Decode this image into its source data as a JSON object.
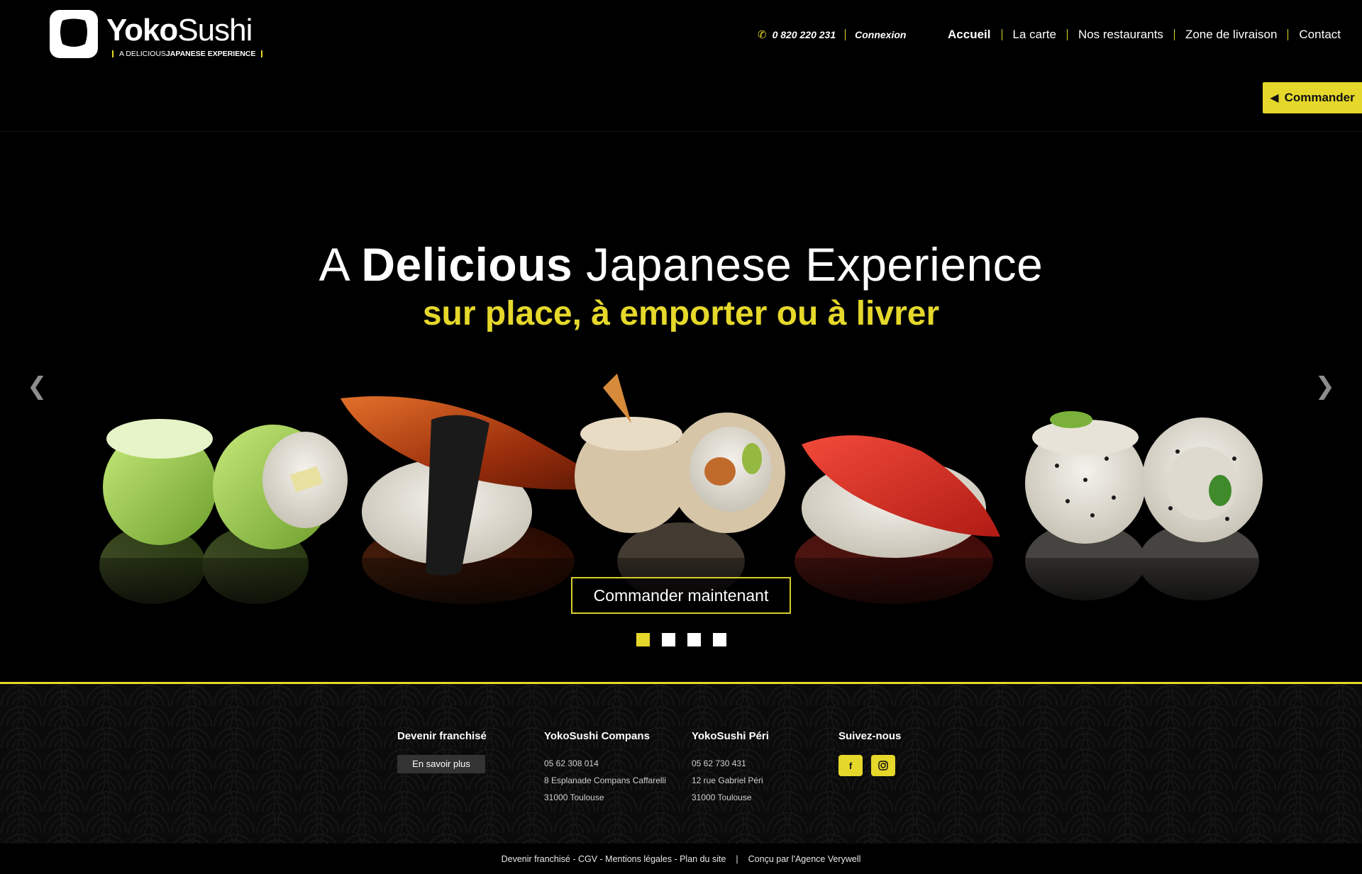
{
  "brand": {
    "name_bold": "Yoko",
    "name_light": "Sushi",
    "tagline_pre": "A DELICIOUS ",
    "tagline_bold": "JAPANESE EXPERIENCE",
    "accent_color": "#e5d82b"
  },
  "topbar": {
    "phone": "0 820 220 231",
    "phone_icon": "phone-icon",
    "login": "Connexion"
  },
  "nav": {
    "items": [
      {
        "label": "Accueil",
        "active": true
      },
      {
        "label": "La carte",
        "active": false
      },
      {
        "label": "Nos restaurants",
        "active": false
      },
      {
        "label": "Zone de livraison",
        "active": false
      },
      {
        "label": "Contact",
        "active": false
      }
    ]
  },
  "order_button": {
    "label": "Commander",
    "icon": "arrow-left-icon"
  },
  "hero": {
    "title_pre": "A ",
    "title_bold": "Delicious",
    "title_post": " Japanese Experience",
    "subtitle": "sur place, à emporter ou à livrer",
    "cta": "Commander maintenant",
    "prev_icon": "chevron-left-icon",
    "next_icon": "chevron-right-icon",
    "slides_total": 4,
    "active_slide": 1
  },
  "footer": {
    "franchise": {
      "title": "Devenir franchisé",
      "button": "En savoir plus"
    },
    "compans": {
      "title": "YokoSushi Compans",
      "phone": "05 62 308 014",
      "address": "8 Esplanade Compans Caffarelli",
      "city": "31000 Toulouse"
    },
    "peri": {
      "title": "YokoSushi Péri",
      "phone": "05 62 730 431",
      "address": "12 rue Gabriel Péri",
      "city": "31000 Toulouse"
    },
    "social": {
      "title": "Suivez-nous",
      "icons": [
        "facebook-icon",
        "instagram-icon"
      ]
    }
  },
  "bottom": {
    "links": "Devenir franchisé - CGV - Mentions légales - Plan du site",
    "credit": "Conçu par l'Agence Verywell"
  }
}
